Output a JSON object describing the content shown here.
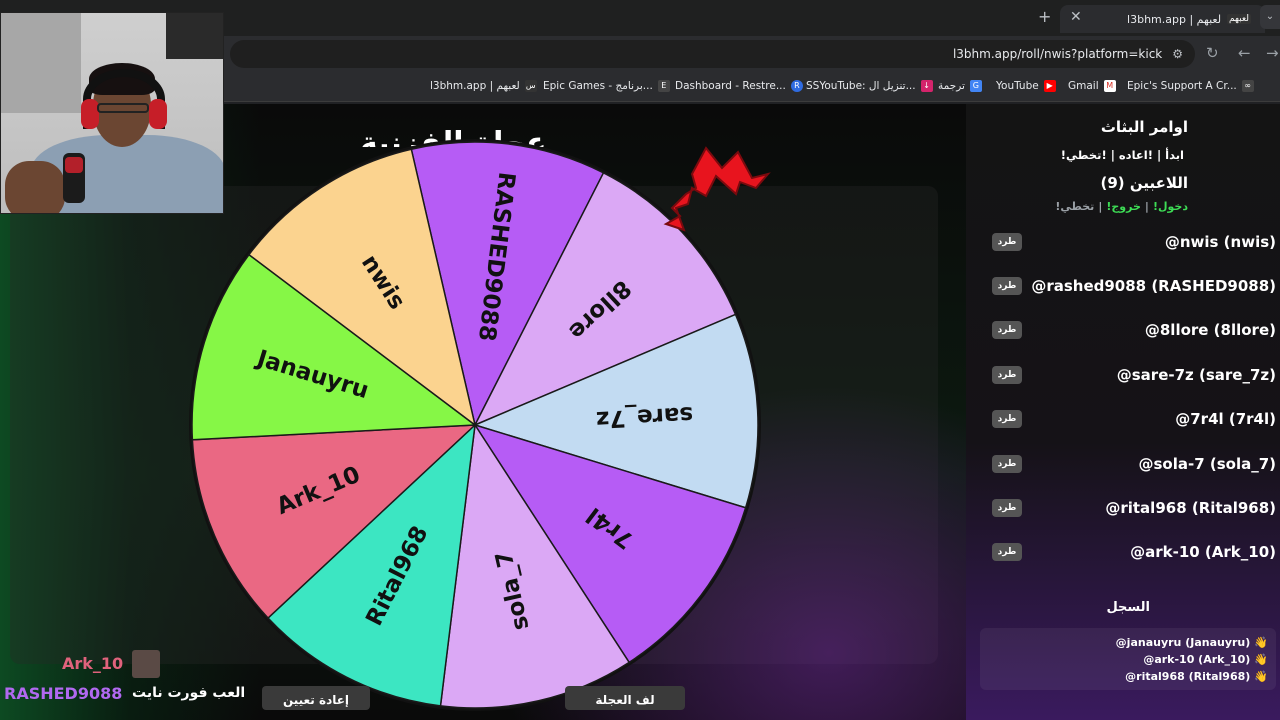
{
  "browser": {
    "tab_title": "l3bhm.app | لعبهم",
    "tab_logo_text": "لعبهم",
    "url": "l3bhm.app/roll/nwis?platform=kick",
    "bookmarks": [
      "l3bhm.app | لعبهم",
      "Epic Games - برنامج...",
      "Dashboard - Restre...",
      "SSYouTube: تنزيل ال...",
      "ترجمة",
      "YouTube",
      "Gmail",
      "Epic's Support A Cr..."
    ]
  },
  "wheel": {
    "title": "عجلة الفزنية",
    "pointer_color": "#e8141e",
    "segments": [
      {
        "label": "RASHED9088",
        "color": "#b65cf5"
      },
      {
        "label": "8llore",
        "color": "#dba8f5"
      },
      {
        "label": "sare_7z",
        "color": "#c2dbf2"
      },
      {
        "label": "7r4l",
        "color": "#b65cf5"
      },
      {
        "label": "sola_7",
        "color": "#dba8f5"
      },
      {
        "label": "Rital968",
        "color": "#3ce6c2"
      },
      {
        "label": "Ark_10",
        "color": "#ea6883"
      },
      {
        "label": "Janauyru",
        "color": "#86f746"
      },
      {
        "label": "nwis",
        "color": "#fbd38f"
      }
    ]
  },
  "sidebar": {
    "commands_title": "اوامر البثاث",
    "commands": "!ابدأ | !اعاده | !تخطي",
    "players_title": "اللاعبين (9)",
    "join": "!دخول",
    "leave": "!خروج",
    "skip": "!تخطي",
    "kick_label": "طرد",
    "players": [
      "@nwis (nwis)",
      "@rashed9088 (RASHED9088)",
      "@8llore (8llore)",
      "@sare-7z (sare_7z)",
      "@7r4l (7r4l)",
      "@sola-7 (sola_7)",
      "@rital968 (Rital968)",
      "@ark-10 (Ark_10)"
    ],
    "log_title": "السجل",
    "log": [
      "@janauyru (Janauyru)",
      "@ark-10 (Ark_10)",
      "@rital968 (Rital968)"
    ]
  },
  "buttons": {
    "reset": "إعادة تعيين",
    "spin": "لف العجلة"
  },
  "chat": {
    "user1": "Ark_10",
    "user2": "RASHED9088",
    "message": "العب فورت نايت"
  }
}
